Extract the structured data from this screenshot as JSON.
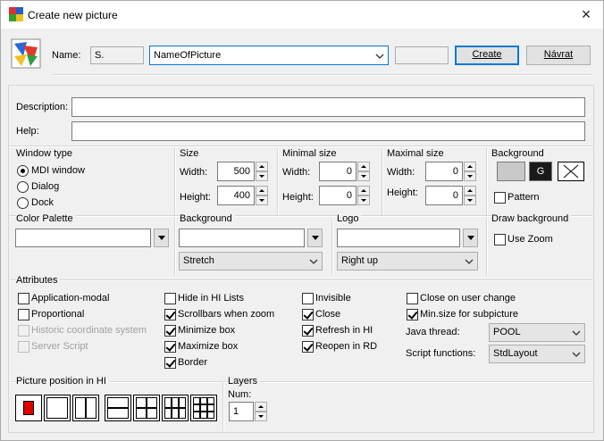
{
  "window": {
    "title": "Create new picture",
    "close": "×"
  },
  "header": {
    "name_label": "Name:",
    "prefix_value": "S.",
    "name_value": "NameOfPicture",
    "create_label": "Create",
    "back_label": "Návrat"
  },
  "description": {
    "label": "Description:",
    "value": ""
  },
  "help": {
    "label": "Help:",
    "value": ""
  },
  "window_type": {
    "title": "Window type",
    "options": [
      "MDI window",
      "Dialog",
      "Dock"
    ],
    "selected": "MDI window"
  },
  "size": {
    "title": "Size",
    "width_label": "Width:",
    "width": "500",
    "height_label": "Height:",
    "height": "400"
  },
  "minimal_size": {
    "title": "Minimal size",
    "width_label": "Width:",
    "width": "0",
    "height_label": "Height:",
    "height": "0"
  },
  "maximal_size": {
    "title": "Maximal size",
    "width_label": "Width:",
    "width": "0",
    "height_label": "Height:",
    "height": "0"
  },
  "background_box": {
    "title": "Background",
    "g_label": "G",
    "pattern_label": "Pattern"
  },
  "color_palette": {
    "title": "Color Palette",
    "value": ""
  },
  "background": {
    "title": "Background",
    "value": "",
    "mode": "Stretch"
  },
  "logo": {
    "title": "Logo",
    "value": "",
    "mode": "Right up"
  },
  "draw_background": {
    "title": "Draw background",
    "use_zoom_label": "Use Zoom"
  },
  "attributes": {
    "title": "Attributes",
    "col1": [
      {
        "label": "Application-modal",
        "checked": false,
        "enabled": true
      },
      {
        "label": "Proportional",
        "checked": false,
        "enabled": true
      },
      {
        "label": "Historic coordinate system",
        "checked": false,
        "enabled": false
      },
      {
        "label": "Server Script",
        "checked": false,
        "enabled": false
      }
    ],
    "col2": [
      {
        "label": "Hide in HI Lists",
        "checked": false
      },
      {
        "label": "Scrollbars when zoom",
        "checked": true
      },
      {
        "label": "Minimize box",
        "checked": true
      },
      {
        "label": "Maximize box",
        "checked": true
      },
      {
        "label": "Border",
        "checked": true
      }
    ],
    "col3": [
      {
        "label": "Invisible",
        "checked": false
      },
      {
        "label": "Close",
        "checked": true
      },
      {
        "label": "Refresh in HI",
        "checked": true
      },
      {
        "label": "Reopen in RD",
        "checked": true
      }
    ],
    "col4": [
      {
        "label": "Close on user change",
        "checked": false
      },
      {
        "label": "Min.size for subpicture",
        "checked": true
      }
    ],
    "java_thread_label": "Java thread:",
    "java_thread_value": "POOL",
    "script_functions_label": "Script functions:",
    "script_functions_value": "StdLayout"
  },
  "picture_position": {
    "title": "Picture position in HI"
  },
  "layers": {
    "title": "Layers",
    "num_label": "Num:",
    "num_value": "1"
  },
  "colors": {
    "accent": "#0078d7",
    "position_selected": "#e00000"
  }
}
